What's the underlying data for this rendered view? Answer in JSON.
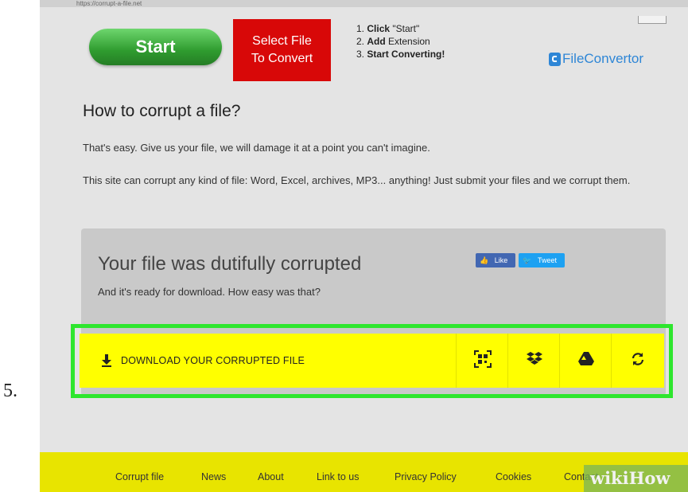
{
  "address_bar": {
    "text": "https://corrupt-a-file.net"
  },
  "step_number": "5.",
  "top": {
    "start_label": "Start",
    "select_label_line1": "Select File",
    "select_label_line2": "To Convert",
    "steps": [
      {
        "num": "1.",
        "bold": "Click",
        "rest": " \"Start\""
      },
      {
        "num": "2.",
        "bold": "Add",
        "rest": " Extension"
      },
      {
        "num": "3.",
        "bold": "Start Converting!",
        "rest": ""
      }
    ],
    "logo_text": "FileConvertor"
  },
  "main": {
    "heading": "How to corrupt a file?",
    "para1": "That's easy. Give us your file, we will damage it at a point you can't imagine.",
    "para2": "This site can corrupt any kind of file: Word, Excel, archives, MP3... anything! Just submit your files and we corrupt them."
  },
  "result": {
    "title": "Your file was dutifully corrupted",
    "subtitle": "And it's ready for download. How easy was that?",
    "like_label": "Like",
    "tweet_label": "Tweet"
  },
  "download": {
    "label": "DOWNLOAD YOUR CORRUPTED FILE",
    "actions": [
      "qr-code-icon",
      "dropbox-icon",
      "google-drive-icon",
      "refresh-icon"
    ]
  },
  "footer": {
    "links": [
      "Corrupt file",
      "News",
      "About",
      "Link to us",
      "Privacy Policy",
      "Cookies",
      "Contact"
    ]
  },
  "watermark": "wikiHow",
  "colors": {
    "start_green": "#2f9c2f",
    "select_red": "#d80808",
    "download_yellow": "#ffff00",
    "highlight_green": "#2ee62e",
    "footer_yellow": "#e8e400",
    "logo_blue": "#2e86d6"
  }
}
